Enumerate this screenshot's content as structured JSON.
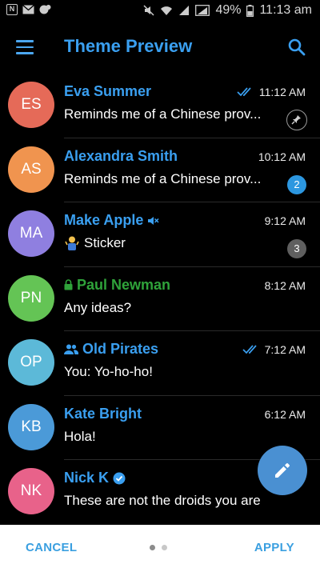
{
  "status_bar": {
    "battery": "49%",
    "time": "11:13 am"
  },
  "app_bar": {
    "title": "Theme Preview"
  },
  "chats": [
    {
      "initials": "ES",
      "avatar_color": "#e56a58",
      "name": "Eva Summer",
      "time": "11:12 AM",
      "message": "Reminds me of a Chinese prov...",
      "read_ticks": true,
      "pinned": true
    },
    {
      "initials": "AS",
      "avatar_color": "#f0944f",
      "name": "Alexandra Smith",
      "time": "10:12 AM",
      "message": "Reminds me of a Chinese prov...",
      "unread": "2"
    },
    {
      "initials": "MA",
      "avatar_color": "#8f7fe0",
      "name": "Make Apple",
      "muted": true,
      "time": "9:12 AM",
      "message": "Sticker",
      "unread": "3"
    },
    {
      "initials": "PN",
      "avatar_color": "#64c455",
      "name": "Paul Newman",
      "secret": true,
      "time": "8:12 AM",
      "message": "Any ideas?"
    },
    {
      "initials": "OP",
      "avatar_color": "#5cb9d8",
      "name": "Old Pirates",
      "group": true,
      "time": "7:12 AM",
      "message": "You: Yo-ho-ho!",
      "read_ticks": true
    },
    {
      "initials": "KB",
      "avatar_color": "#4b9ad8",
      "name": "Kate Bright",
      "time": "6:12 AM",
      "message": "Hola!"
    },
    {
      "initials": "NK",
      "avatar_color": "#e8628a",
      "name": "Nick K",
      "verified": true,
      "time": "",
      "message": "These are not the droids you are"
    }
  ],
  "bottom_bar": {
    "cancel": "CANCEL",
    "apply": "APPLY"
  },
  "colors": {
    "accent": "#3a9ff0",
    "background": "#000000",
    "secret_name": "#2fa33a"
  }
}
